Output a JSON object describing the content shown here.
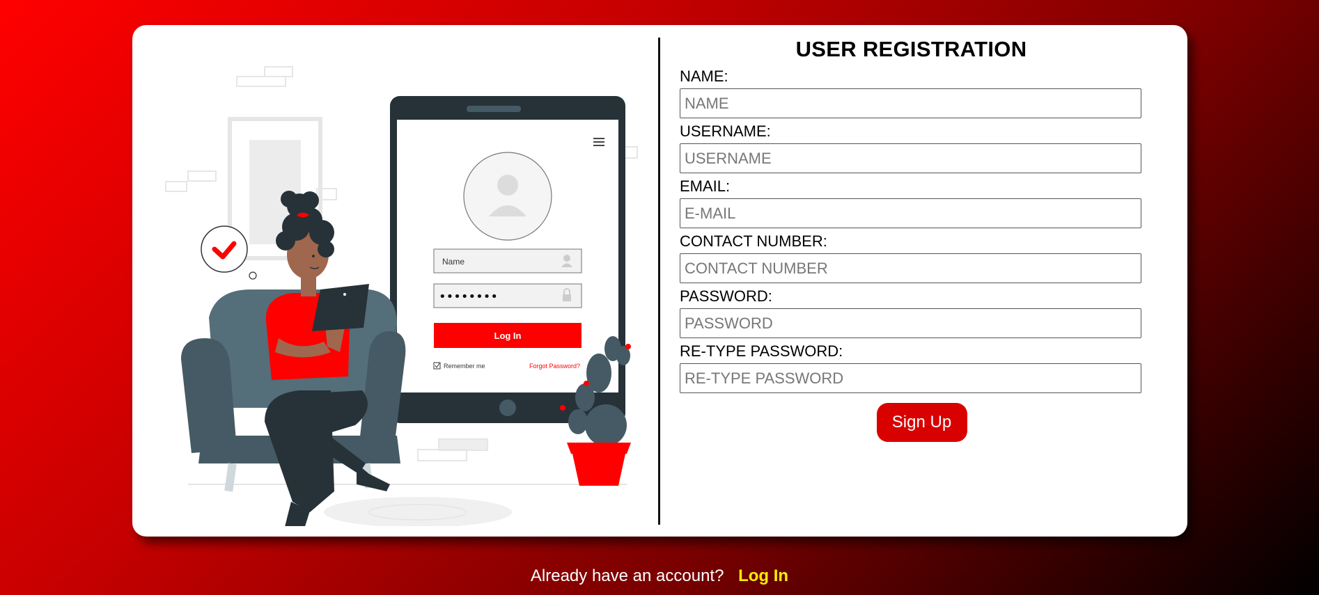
{
  "form": {
    "title": "USER REGISTRATION",
    "fields": [
      {
        "label": "NAME:",
        "placeholder": "NAME"
      },
      {
        "label": "USERNAME:",
        "placeholder": "USERNAME"
      },
      {
        "label": "EMAIL:",
        "placeholder": "E-MAIL"
      },
      {
        "label": "CONTACT NUMBER:",
        "placeholder": "CONTACT NUMBER"
      },
      {
        "label": "PASSWORD:",
        "placeholder": "PASSWORD"
      },
      {
        "label": "RE-TYPE PASSWORD:",
        "placeholder": "RE-TYPE PASSWORD"
      }
    ],
    "submit_label": "Sign Up"
  },
  "illustration": {
    "login_name_placeholder": "Name",
    "login_password_dots": "••••••••",
    "login_button": "Log In",
    "remember_me": "Remember me",
    "forgot_password": "Forgot Password?"
  },
  "footer": {
    "prompt": "Already have an account?",
    "login_link": "Log In"
  },
  "colors": {
    "accent": "#ff0000",
    "button": "#d90000",
    "link": "#ffee00"
  }
}
